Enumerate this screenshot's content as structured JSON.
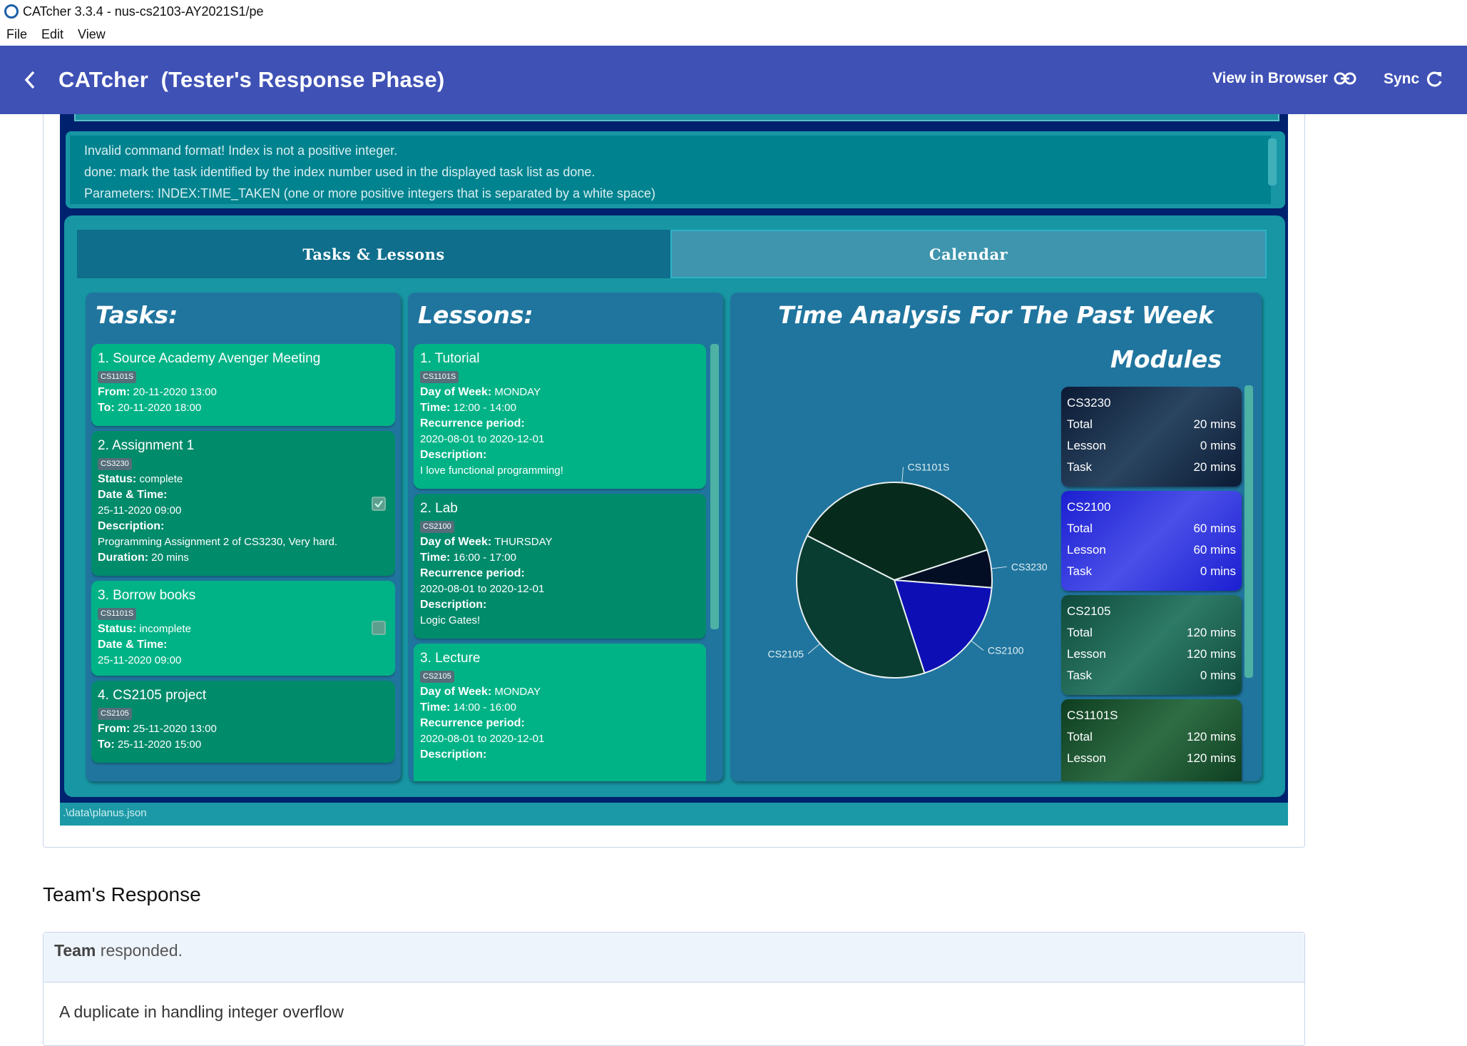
{
  "window": {
    "title": "CATcher 3.3.4 - nus-cs2103-AY2021S1/pe"
  },
  "menu": [
    "File",
    "Edit",
    "View"
  ],
  "appbar": {
    "title": "CATcher  (Tester's Response Phase)",
    "view_in_browser": "View in Browser",
    "sync": "Sync"
  },
  "result_box": {
    "lines": [
      "Invalid command format! Index is not a positive integer.",
      "done: mark the task identified by the index number used in the displayed task list as done.",
      "Parameters: INDEX:TIME_TAKEN (one or more positive integers that is separated by a white space)"
    ]
  },
  "tabs": [
    "Tasks & Lessons",
    "Calendar"
  ],
  "tasks": {
    "heading": "Tasks:",
    "items": [
      {
        "title": "1.  Source Academy Avenger Meeting",
        "tag": "CS1101S",
        "fields": [
          [
            "From:",
            "20-11-2020 13:00"
          ],
          [
            "To:",
            "20-11-2020 18:00"
          ]
        ]
      },
      {
        "title": "2.  Assignment 1",
        "tag": "CS3230",
        "status_label": "Status:",
        "status": "complete",
        "dt_label": "Date & Time:",
        "dt": "25-11-2020 09:00",
        "desc_label": "Description:",
        "desc": "Programming Assignment 2 of CS3230, Very hard.",
        "dur_label": "Duration:",
        "dur": "20 mins"
      },
      {
        "title": "3.  Borrow books",
        "tag": "CS1101S",
        "status_label": "Status:",
        "status": "incomplete",
        "dt_label": "Date & Time:",
        "dt": "25-11-2020 09:00"
      },
      {
        "title": "4.  CS2105 project",
        "tag": "CS2105",
        "fields": [
          [
            "From:",
            "25-11-2020 13:00"
          ],
          [
            "To:",
            "25-11-2020 15:00"
          ]
        ]
      }
    ]
  },
  "lessons": {
    "heading": "Lessons:",
    "items": [
      {
        "title": "1.  Tutorial",
        "tag": "CS1101S",
        "dow_label": "Day of Week:",
        "dow": "MONDAY",
        "time_label": "Time:",
        "time": "12:00 - 14:00",
        "rec_label": "Recurrence period:",
        "rec": "2020-08-01 to 2020-12-01",
        "desc_label": "Description:",
        "desc": "I love functional programming!"
      },
      {
        "title": "2.  Lab",
        "tag": "CS2100",
        "dow_label": "Day of Week:",
        "dow": "THURSDAY",
        "time_label": "Time:",
        "time": "16:00 - 17:00",
        "rec_label": "Recurrence period:",
        "rec": "2020-08-01 to 2020-12-01",
        "desc_label": "Description:",
        "desc": "Logic Gates!"
      },
      {
        "title": "3.  Lecture",
        "tag": "CS2105",
        "dow_label": "Day of Week:",
        "dow": "MONDAY",
        "time_label": "Time:",
        "time": "14:00 - 16:00",
        "rec_label": "Recurrence period:",
        "rec": "2020-08-01 to 2020-12-01",
        "desc_label": "Description:",
        "desc": ""
      }
    ]
  },
  "analysis": {
    "heading": "Time Analysis For The Past Week",
    "modules_heading": "Modules"
  },
  "chart_data": {
    "type": "pie",
    "categories": [
      "CS1101S",
      "CS3230",
      "CS2100",
      "CS2105"
    ],
    "values": [
      120,
      20,
      60,
      120
    ],
    "colors": [
      "#062a1c",
      "#030d24",
      "#0d0fb5",
      "#093d32"
    ]
  },
  "modules": [
    {
      "code": "CS3230",
      "total": "20 mins",
      "lesson": "0 mins",
      "task": "20 mins",
      "bg": "linear-gradient(135deg,#0b1a35,#2a4560 50%,#0b1a35)"
    },
    {
      "code": "CS2100",
      "total": "60 mins",
      "lesson": "60 mins",
      "task": "0 mins",
      "bg": "linear-gradient(135deg,#1b1fd1,#4a4fe8 50%,#1b1fd1)"
    },
    {
      "code": "CS2105",
      "total": "120 mins",
      "lesson": "120 mins",
      "task": "0 mins",
      "bg": "linear-gradient(135deg,#0f4a3c,#2d7a66 50%,#0f4a3c)"
    },
    {
      "code": "CS1101S",
      "total": "120 mins",
      "lesson": "120 mins",
      "task": "",
      "bg": "linear-gradient(135deg,#0d3d1f,#2f6e45 50%,#0d3d1f)"
    }
  ],
  "module_labels": {
    "total": "Total",
    "lesson": "Lesson",
    "task": "Task"
  },
  "status_path": ".\\data\\planus.json",
  "team": {
    "heading": "Team's Response",
    "who": "Team",
    "action": "responded.",
    "body": "A duplicate in handling integer overflow"
  }
}
